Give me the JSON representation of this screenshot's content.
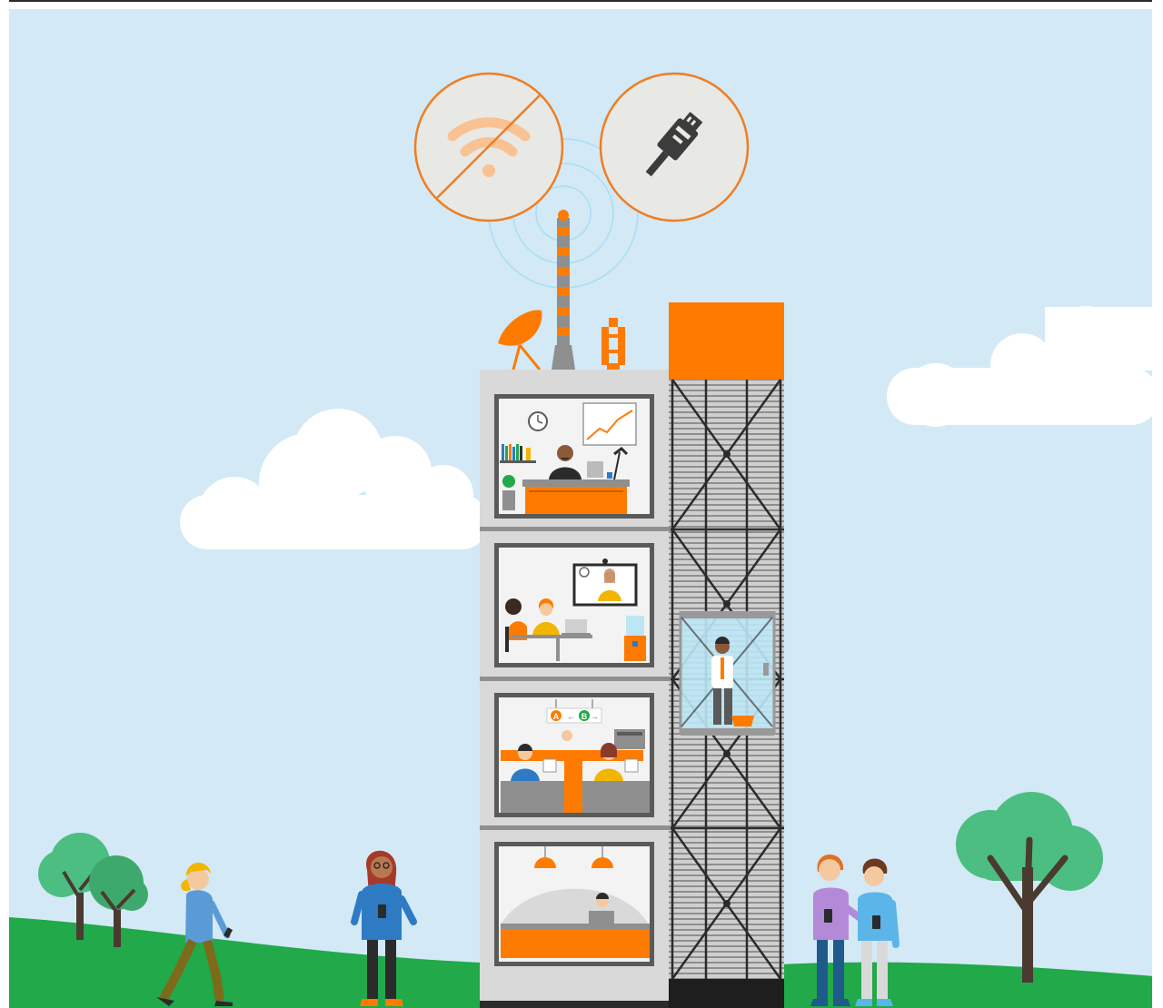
{
  "colors": {
    "sky": "#d3e9f6",
    "grass": "#21a94a",
    "accent_orange": "#f57c00",
    "building_gray": "#d9d9d9",
    "frame_gray": "#666666",
    "cloud": "#ffffff",
    "tree_leaf": "#4cbe82",
    "trunk": "#4a3a30"
  },
  "icons": {
    "wifi_off": "no-wifi-icon",
    "wired_plug": "ethernet-plug-icon"
  },
  "floors": [
    {
      "name": "executive-office"
    },
    {
      "name": "video-conference-room"
    },
    {
      "name": "open-plan-office"
    },
    {
      "name": "reception-lobby"
    }
  ],
  "signage": {
    "sign_a": "A",
    "sign_b": "B"
  }
}
